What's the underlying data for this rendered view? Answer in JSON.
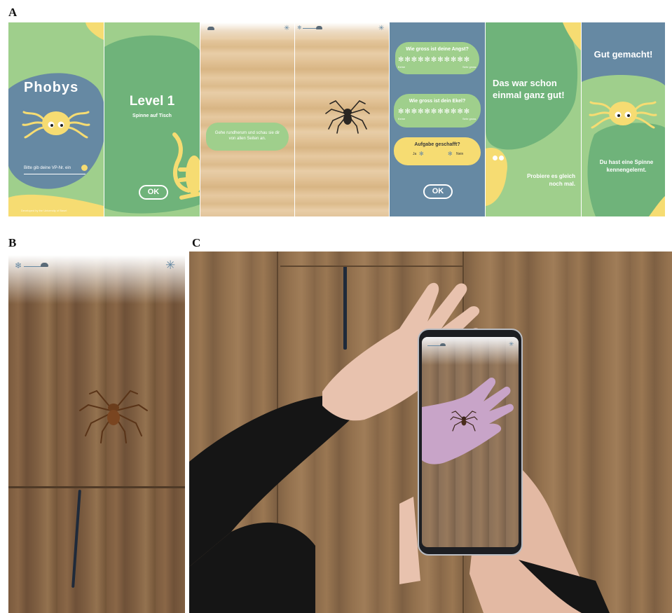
{
  "panels": {
    "a": "A",
    "b": "B",
    "c": "C"
  },
  "colors": {
    "green": "#9fcf8c",
    "green_dark": "#6fb37a",
    "blue": "#6689a3",
    "yellow": "#f6dc72",
    "white": "#ffffff"
  },
  "screens": {
    "s1": {
      "logo": "Phobys",
      "prompt": "Bitte gib deine VP-Nr. ein",
      "footer": "Developed by the University of Basel"
    },
    "s2": {
      "title": "Level 1",
      "subtitle": "Spinne auf Tisch",
      "ok": "OK"
    },
    "s3": {
      "instruction": "Gehe rundherum und schau sie dir von allen Seiten an."
    },
    "s5": {
      "q1": "Wie gross ist deine Angst?",
      "q1_low": "Keine",
      "q1_high": "Sehr gross",
      "q2": "Wie gross ist dein Ekel?",
      "q2_low": "Keine",
      "q2_high": "Sehr gross",
      "q3": "Aufgabe geschafft?",
      "yes": "Ja",
      "no": "Nein",
      "ok": "OK"
    },
    "s6": {
      "title": "Das war schon einmal ganz gut!",
      "body": "Probiere es gleich noch mal."
    },
    "s7": {
      "title": "Gut gemacht!",
      "body": "Du hast eine Spinne kennengelernt."
    }
  },
  "icons": [
    "snowflake-icon",
    "spider-small-icon",
    "cobweb-icon",
    "spider-icon"
  ]
}
